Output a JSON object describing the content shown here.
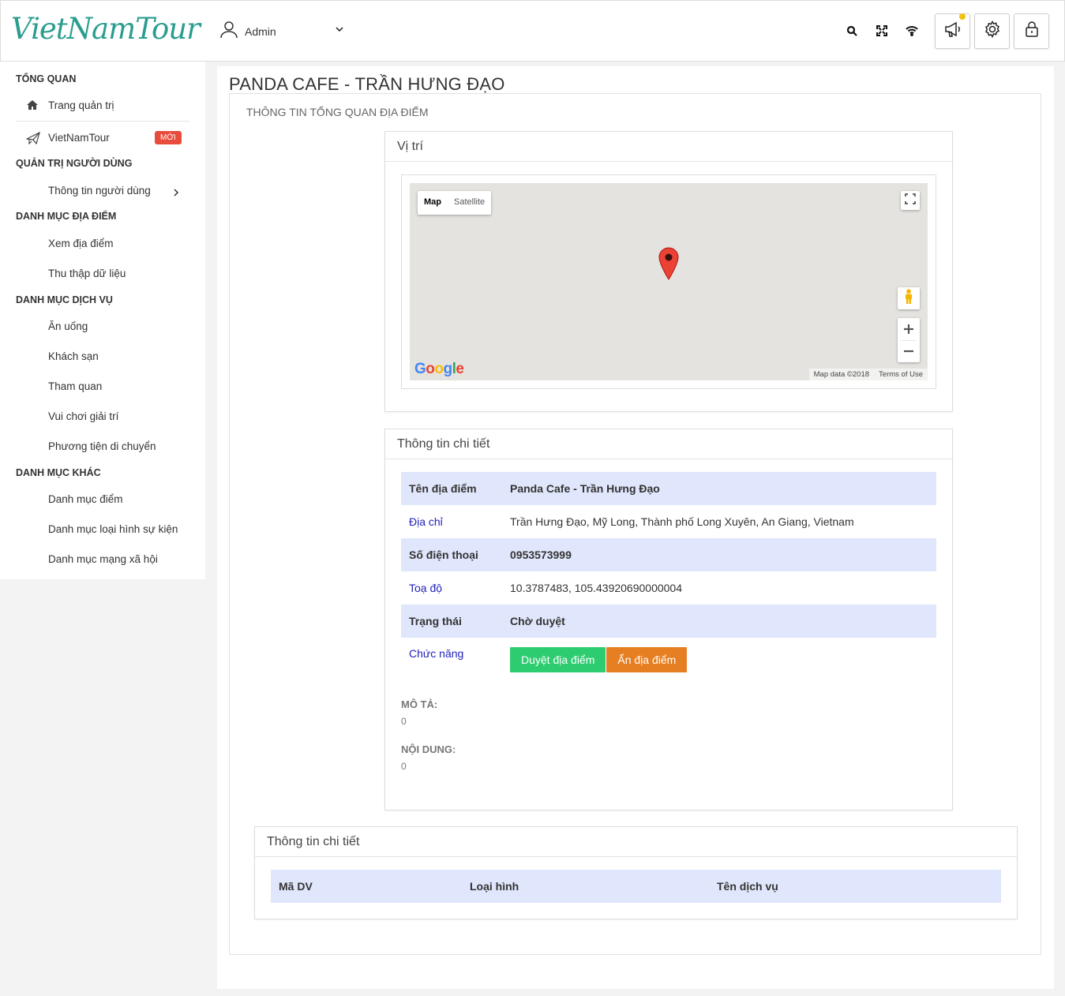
{
  "header": {
    "logo": "VietNamTour",
    "user": "Admin",
    "icons": [
      "search-icon",
      "fullscreen-icon",
      "wifi-icon",
      "megaphone-icon",
      "gear-icon",
      "lock-icon"
    ]
  },
  "sidebar": {
    "sections": [
      {
        "title": "TỔNG QUAN",
        "items": [
          {
            "label": "Trang quản trị",
            "icon": "home-icon"
          },
          {
            "label": "VietNamTour",
            "icon": "paper-plane-icon",
            "badge": "MỚI"
          }
        ]
      },
      {
        "title": "QUẢN TRỊ NGƯỜI DÙNG",
        "items": [
          {
            "label": "Thông tin người dùng"
          }
        ]
      },
      {
        "title": "DANH MỤC ĐỊA ĐIỂM",
        "items": [
          {
            "label": "Xem địa điểm"
          },
          {
            "label": "Thu thập dữ liệu"
          }
        ]
      },
      {
        "title": "DANH MỤC DỊCH VỤ",
        "items": [
          {
            "label": "Ăn uống"
          },
          {
            "label": "Khách sạn"
          },
          {
            "label": "Tham quan"
          },
          {
            "label": "Vui chơi giải trí"
          },
          {
            "label": "Phương tiện di chuyển"
          }
        ]
      },
      {
        "title": "DANH MỤC KHÁC",
        "items": [
          {
            "label": "Danh mục điểm"
          },
          {
            "label": "Danh mục loại hình sự kiện"
          },
          {
            "label": "Danh mục mạng xã hội"
          }
        ]
      }
    ]
  },
  "page": {
    "title": "PANDA CAFE - TRẦN HƯNG ĐẠO",
    "overview_title": "THÔNG TIN TỔNG QUAN ĐỊA ĐIỂM"
  },
  "location_panel": {
    "title": "Vị trí",
    "map_type_map": "Map",
    "map_type_satellite": "Satellite",
    "google": "Google",
    "map_data": "Map data ©2018",
    "terms": "Terms of Use"
  },
  "detail_panel": {
    "title": "Thông tin chi tiết",
    "rows": [
      {
        "key": "Tên địa điểm",
        "value": "Panda Cafe - Trần Hưng Đạo"
      },
      {
        "key": "Địa chỉ",
        "value": "Trần Hưng Đạo, Mỹ Long, Thành phố Long Xuyên, An Giang, Vietnam"
      },
      {
        "key": "Số điện thoại",
        "value": "0953573999"
      },
      {
        "key": "Toạ độ",
        "value": "10.3787483, 105.43920690000004"
      },
      {
        "key": "Trạng thái",
        "value": "Chờ duyệt"
      },
      {
        "key": "Chức năng"
      }
    ],
    "approve_button": "Duyệt địa điểm",
    "hide_button": "Ẩn địa điểm",
    "description_label": "MÔ TẢ:",
    "description_value": "0",
    "content_label": "NỘI DUNG:",
    "content_value": "0"
  },
  "service_panel": {
    "title": "Thông tin chi tiết",
    "columns": [
      "Mã DV",
      "Loại hình",
      "Tên dịch vụ"
    ]
  },
  "colors": {
    "brand": "#2a9d8f",
    "highlight_row": "#e0e6fb",
    "approve": "#2ecc71",
    "hide": "#e67e22",
    "badge": "#e74c3c"
  }
}
